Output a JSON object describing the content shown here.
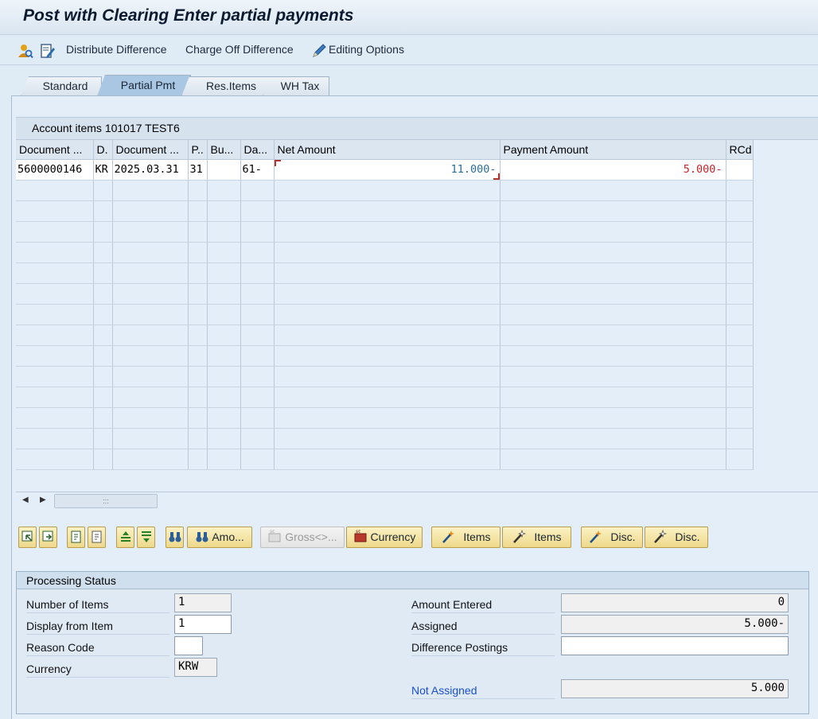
{
  "title": "Post with Clearing Enter partial payments",
  "toolbar": {
    "distribute_difference": "Distribute Difference",
    "charge_off_difference": "Charge Off Difference",
    "editing_options": "Editing Options"
  },
  "tabs": [
    "Standard",
    "Partial Pmt",
    "Res.Items",
    "WH Tax"
  ],
  "active_tab": "Partial Pmt",
  "grid": {
    "title": "Account items 101017 TEST6",
    "columns": [
      "Document ...",
      "D.",
      "Document ...",
      "P..",
      "Bu...",
      "Da...",
      "Net Amount",
      "Payment Amount",
      "RCd"
    ],
    "rows": [
      {
        "document_no": "5600000146",
        "doc_type": "KR",
        "document_date": "2025.03.31",
        "posting_key": "31",
        "business_area": "",
        "days": "61-",
        "net_amount": "11.000-",
        "payment_amount": "5.000-",
        "reason_code": ""
      }
    ]
  },
  "buttons": {
    "amount": "Amo...",
    "gross": "Gross<>...",
    "currency": "Currency",
    "items_activate": "Items",
    "items_deactivate": "Items",
    "disc_activate": "Disc.",
    "disc_deactivate": "Disc."
  },
  "status": {
    "title": "Processing Status",
    "number_of_items_label": "Number of Items",
    "number_of_items": "1",
    "display_from_item_label": "Display from Item",
    "display_from_item": "1",
    "reason_code_label": "Reason Code",
    "reason_code": "",
    "currency_label": "Currency",
    "currency": "KRW",
    "amount_entered_label": "Amount Entered",
    "amount_entered": "0",
    "assigned_label": "Assigned",
    "assigned": "5.000-",
    "difference_postings_label": "Difference Postings",
    "difference_postings": "",
    "not_assigned_label": "Not Assigned",
    "not_assigned": "5.000"
  },
  "colors": {
    "net_amount": "#2c6f9b",
    "payment_amount": "#c0262b",
    "not_assigned_label": "#1a4fd1"
  }
}
